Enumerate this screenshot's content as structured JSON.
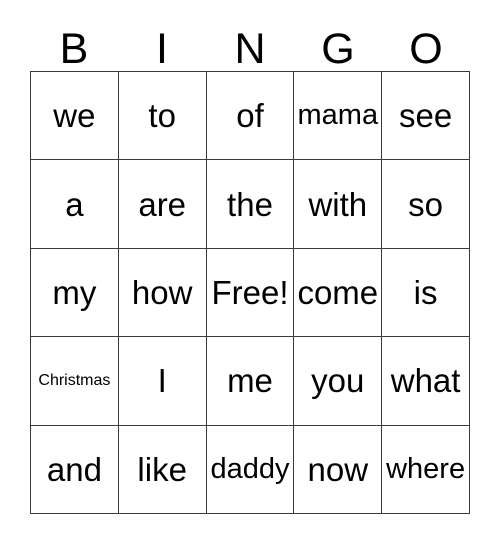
{
  "card": {
    "title_letters": [
      "B",
      "I",
      "N",
      "G",
      "O"
    ],
    "colors": {
      "background": "#ffffff",
      "grid_line": "#3a3a3a",
      "text": "#000000"
    },
    "rows": [
      [
        {
          "text": "we",
          "size": "lg"
        },
        {
          "text": "to",
          "size": "lg"
        },
        {
          "text": "of",
          "size": "lg"
        },
        {
          "text": "mama",
          "size": "md"
        },
        {
          "text": "see",
          "size": "lg"
        }
      ],
      [
        {
          "text": "a",
          "size": "lg"
        },
        {
          "text": "are",
          "size": "lg"
        },
        {
          "text": "the",
          "size": "lg"
        },
        {
          "text": "with",
          "size": "lg"
        },
        {
          "text": "so",
          "size": "lg"
        }
      ],
      [
        {
          "text": "my",
          "size": "lg"
        },
        {
          "text": "how",
          "size": "lg"
        },
        {
          "text": "Free!",
          "size": "lg"
        },
        {
          "text": "come",
          "size": "lg"
        },
        {
          "text": "is",
          "size": "lg"
        }
      ],
      [
        {
          "text": "Christmas",
          "size": "xs"
        },
        {
          "text": "I",
          "size": "lg"
        },
        {
          "text": "me",
          "size": "lg"
        },
        {
          "text": "you",
          "size": "lg"
        },
        {
          "text": "what",
          "size": "lg"
        }
      ],
      [
        {
          "text": "and",
          "size": "lg"
        },
        {
          "text": "like",
          "size": "lg"
        },
        {
          "text": "daddy",
          "size": "md"
        },
        {
          "text": "now",
          "size": "lg"
        },
        {
          "text": "where",
          "size": "md"
        }
      ]
    ]
  }
}
